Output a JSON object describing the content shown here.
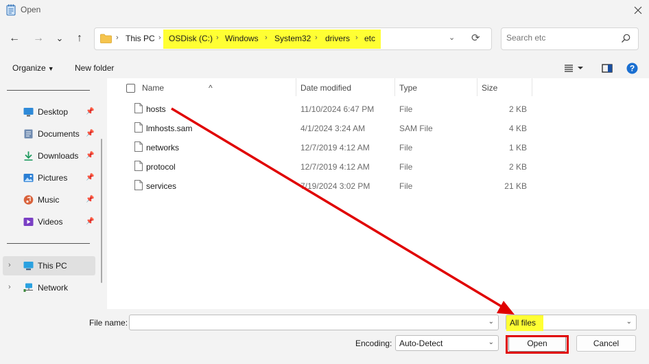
{
  "window": {
    "title": "Open"
  },
  "nav": {
    "back": "←",
    "forward": "→",
    "recent": "⌄",
    "up": "↑",
    "breadcrumb": [
      "This PC",
      "OSDisk (C:)",
      "Windows",
      "System32",
      "drivers",
      "etc"
    ],
    "search_placeholder": "Search etc"
  },
  "toolbar": {
    "organize": "Organize",
    "new_folder": "New folder"
  },
  "sidebar": {
    "quick_access": [
      {
        "label": "Desktop",
        "icon": "desktop-icon"
      },
      {
        "label": "Documents",
        "icon": "documents-icon"
      },
      {
        "label": "Downloads",
        "icon": "downloads-icon"
      },
      {
        "label": "Pictures",
        "icon": "pictures-icon"
      },
      {
        "label": "Music",
        "icon": "music-icon"
      },
      {
        "label": "Videos",
        "icon": "videos-icon"
      }
    ],
    "locations": [
      {
        "label": "This PC",
        "icon": "this-pc-icon",
        "selected": true
      },
      {
        "label": "Network",
        "icon": "network-icon",
        "selected": false
      }
    ]
  },
  "files": {
    "columns": [
      "Name",
      "Date modified",
      "Type",
      "Size"
    ],
    "rows": [
      {
        "name": "hosts",
        "date": "11/10/2024 6:47 PM",
        "type": "File",
        "size": "2 KB"
      },
      {
        "name": "lmhosts.sam",
        "date": "4/1/2024 3:24 AM",
        "type": "SAM File",
        "size": "4 KB"
      },
      {
        "name": "networks",
        "date": "12/7/2019 4:12 AM",
        "type": "File",
        "size": "1 KB"
      },
      {
        "name": "protocol",
        "date": "12/7/2019 4:12 AM",
        "type": "File",
        "size": "2 KB"
      },
      {
        "name": "services",
        "date": "7/19/2024 3:02 PM",
        "type": "File",
        "size": "21 KB"
      }
    ]
  },
  "footer": {
    "file_name_label": "File name:",
    "file_name_value": "",
    "file_type_filter": "All files",
    "encoding_label": "Encoding:",
    "encoding_value": "Auto-Detect",
    "open_label": "Open",
    "cancel_label": "Cancel"
  },
  "colors": {
    "highlight": "#ffff33",
    "annotation_red": "#e00000",
    "help_blue": "#1a6fd1"
  }
}
